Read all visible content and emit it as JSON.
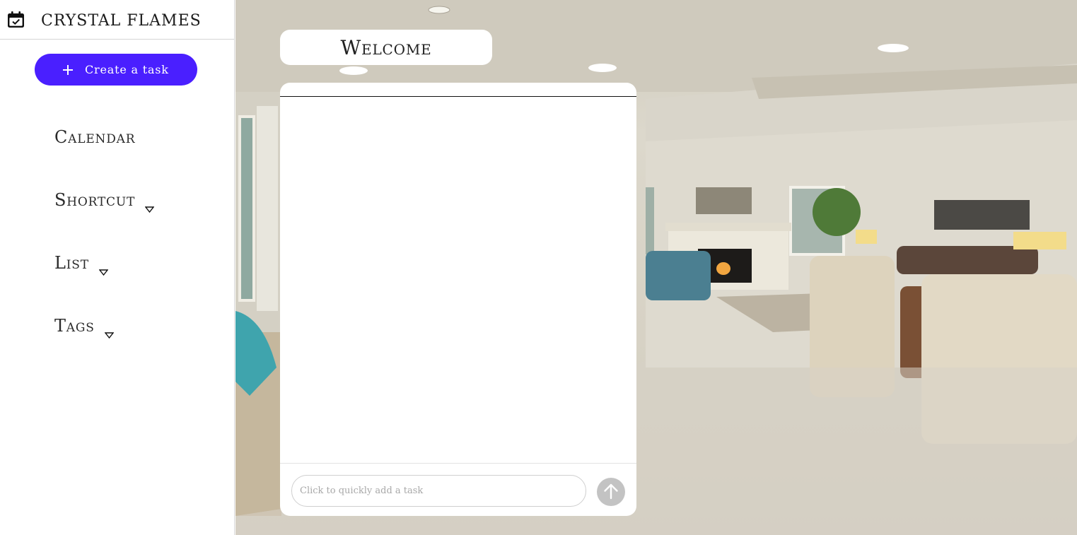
{
  "sidebar": {
    "brand": {
      "name": "CRYSTAL FLAMES",
      "icon": "calendar-check-icon"
    },
    "create_button": {
      "label": "Create a task",
      "icon": "plus-icon"
    },
    "nav": [
      {
        "label": "Calendar",
        "has_dropdown": false
      },
      {
        "label": "Shortcut",
        "has_dropdown": true
      },
      {
        "label": "List",
        "has_dropdown": true
      },
      {
        "label": "Tags",
        "has_dropdown": true
      }
    ]
  },
  "main": {
    "welcome_label": "Welcome",
    "quick_add": {
      "placeholder": "Click to quickly add a task",
      "value": ""
    },
    "send_icon": "arrow-up-icon",
    "colors": {
      "accent": "#4a1fff",
      "send_button": "#c3c3c3"
    }
  }
}
